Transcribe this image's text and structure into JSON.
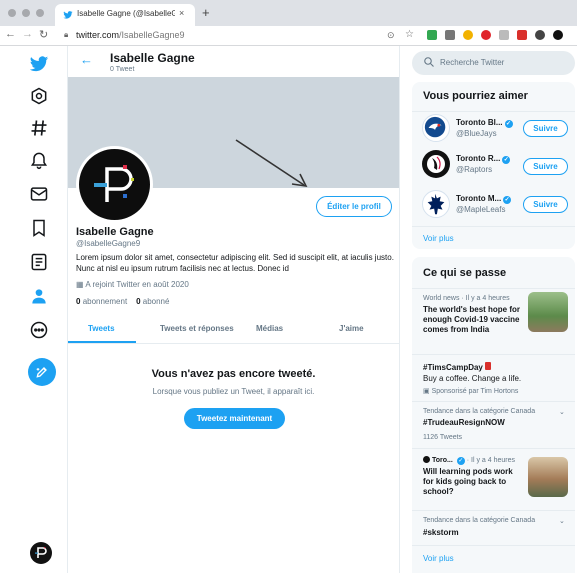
{
  "browser": {
    "tab_title": "Isabelle Gagne (@IsabelleGagn",
    "tab_close": "×",
    "new_tab": "+",
    "url_host": "twitter.com",
    "url_path": "/IsabelleGagne9"
  },
  "header": {
    "name": "Isabelle Gagne",
    "tweet_count": "0 Tweet"
  },
  "profile": {
    "edit_button": "Éditer le profil",
    "name": "Isabelle Gagne",
    "handle": "@IsabelleGagne9",
    "bio": "Lorem ipsum dolor sit amet, consectetur adipiscing elit. Sed id suscipit elit, at iaculis justo. Nunc at nisl eu ipsum rutrum facilisis nec at lectus. Donec id",
    "joined": "A rejoint Twitter en août 2020",
    "following_count": "0",
    "following_label": "abonnement",
    "followers_count": "0",
    "followers_label": "abonné"
  },
  "tabs": [
    "Tweets",
    "Tweets et réponses",
    "Médias",
    "J'aime"
  ],
  "empty_state": {
    "title": "Vous n'avez pas encore tweeté.",
    "subtitle": "Lorsque vous publiez un Tweet, il apparaît ici.",
    "button": "Tweetez maintenant"
  },
  "search": {
    "placeholder": "Recherche Twitter"
  },
  "suggestions": {
    "title": "Vous pourriez aimer",
    "items": [
      {
        "name": "Toronto Bl...",
        "handle": "@BlueJays",
        "button": "Suivre"
      },
      {
        "name": "Toronto R...",
        "handle": "@Raptors",
        "button": "Suivre"
      },
      {
        "name": "Toronto M...",
        "handle": "@MapleLeafs",
        "button": "Suivre"
      }
    ],
    "more": "Voir plus"
  },
  "trends": {
    "title": "Ce qui se passe",
    "items": [
      {
        "meta": "World news · Il y a 4 heures",
        "headline": "The world's best hope for enough Covid-19 vaccine comes from India"
      },
      {
        "headline": "#TimsCampDay",
        "body": "Buy a coffee. Change a life.",
        "promo": "Sponsorisé par Tim Hortons"
      },
      {
        "meta": "Tendance dans la catégorie Canada",
        "headline": "#TrudeauResignNOW",
        "count": "1126 Tweets"
      },
      {
        "meta_source": "Toro...",
        "meta_time": "· Il y a 4 heures",
        "headline": "Will learning pods work for kids going back to school?"
      },
      {
        "meta": "Tendance dans la catégorie Canada",
        "headline": "#skstorm"
      }
    ],
    "more": "Voir plus"
  },
  "colors": {
    "accent": "#1da1f2",
    "banner": "#cdd6dd",
    "panel": "#f5f8fa",
    "text_primary": "#14171a",
    "text_secondary": "#657786"
  },
  "icons": {
    "nav": [
      "twitter-bird-icon",
      "explore-icon",
      "hashtag-icon",
      "notifications-icon",
      "messages-icon",
      "bookmark-icon",
      "lists-icon",
      "profile-icon",
      "more-icon",
      "compose-tweet-icon"
    ]
  }
}
